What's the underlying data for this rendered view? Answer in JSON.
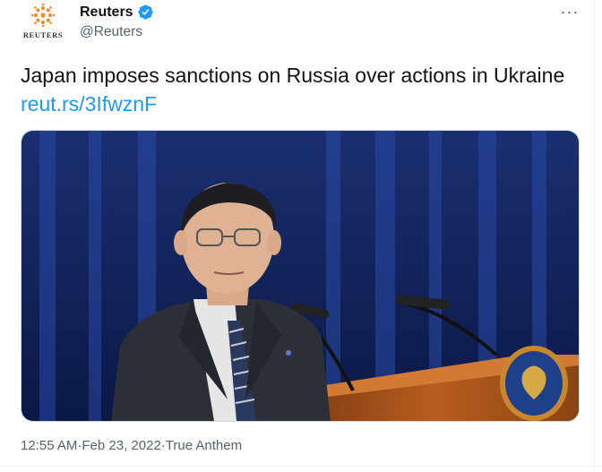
{
  "author": {
    "display_name": "Reuters",
    "handle": "@Reuters",
    "avatar_wordmark": "REUTERS",
    "verified": true,
    "verified_icon": "verified-badge-icon"
  },
  "tweet": {
    "text": "Japan imposes sanctions on Russia over actions in Ukraine ",
    "link": "reut.rs/3IfwznF"
  },
  "media": {
    "image_icon": "photo-image"
  },
  "meta": {
    "time": "12:55 AM",
    "separator": " · ",
    "date": "Feb 23, 2022",
    "source": "True Anthem"
  },
  "menu": {
    "more_label": "···"
  },
  "colors": {
    "link": "#1d9bf0",
    "secondary_text": "#536471",
    "verified": "#1d9bf0",
    "logo_orange": "#f28c28"
  }
}
